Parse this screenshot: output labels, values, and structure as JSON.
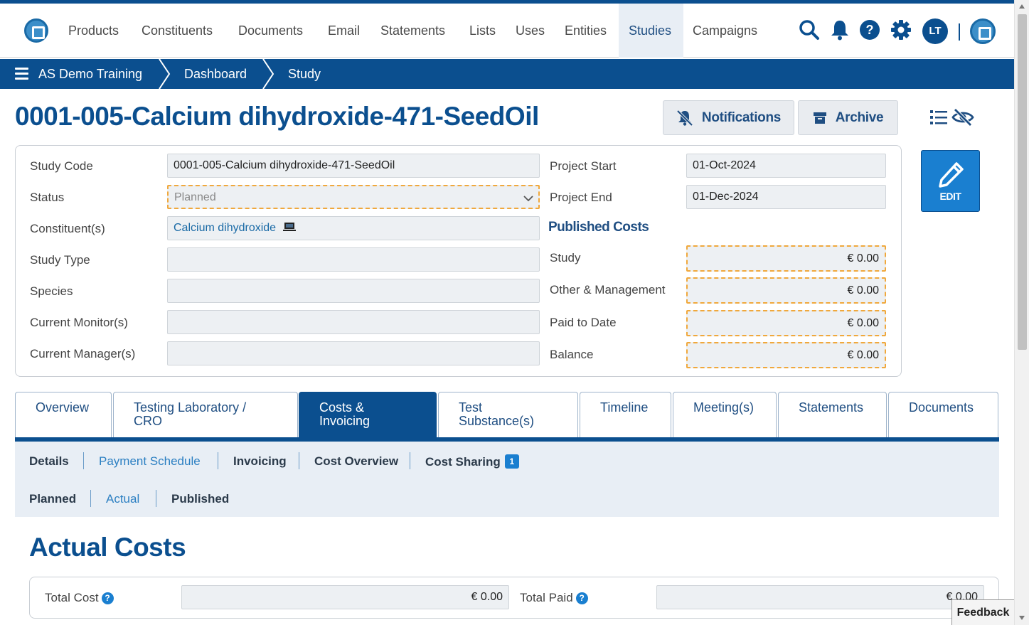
{
  "nav": {
    "items": [
      "Products",
      "Constituents",
      "Documents",
      "Email",
      "Statements",
      "Lists",
      "Uses",
      "Entities",
      "Studies",
      "Campaigns"
    ],
    "active": "Studies",
    "avatar": "LT"
  },
  "breadcrumb": {
    "items": [
      "AS Demo Training",
      "Dashboard",
      "Study"
    ]
  },
  "header": {
    "title": "0001-005-Calcium dihydroxide-471-SeedOil",
    "notifications_label": "Notifications",
    "archive_label": "Archive",
    "edit_label": "EDIT"
  },
  "form": {
    "left": [
      {
        "label": "Study Code",
        "value": "0001-005-Calcium dihydroxide-471-SeedOil"
      },
      {
        "label": "Status",
        "value": "Planned"
      },
      {
        "label": "Constituent(s)",
        "value": "Calcium dihydroxide"
      },
      {
        "label": "Study Type",
        "value": ""
      },
      {
        "label": "Species",
        "value": ""
      },
      {
        "label": "Current Monitor(s)",
        "value": ""
      },
      {
        "label": "Current Manager(s)",
        "value": ""
      }
    ],
    "right": [
      {
        "label": "Project Start",
        "value": "01-Oct-2024"
      },
      {
        "label": "Project End",
        "value": "01-Dec-2024"
      }
    ],
    "published_costs_heading": "Published Costs",
    "costs": [
      {
        "label": "Study",
        "value": "€ 0.00"
      },
      {
        "label": "Other & Management",
        "value": "€ 0.00"
      },
      {
        "label": "Paid to Date",
        "value": "€ 0.00"
      },
      {
        "label": "Balance",
        "value": "€ 0.00"
      }
    ]
  },
  "tabs": [
    {
      "label": "Overview"
    },
    {
      "label": "Testing Laboratory / CRO"
    },
    {
      "label": "Costs & Invoicing"
    },
    {
      "label": "Test Substance(s)"
    },
    {
      "label": "Timeline"
    },
    {
      "label": "Meeting(s)"
    },
    {
      "label": "Statements"
    },
    {
      "label": "Documents"
    }
  ],
  "active_tab": "Costs & Invoicing",
  "subnav": {
    "row1": [
      "Details",
      "Payment Schedule",
      "Invoicing",
      "Cost Overview",
      "Cost Sharing"
    ],
    "cost_sharing_badge": "1",
    "row2": [
      "Planned",
      "Actual",
      "Published"
    ]
  },
  "actual_costs": {
    "title": "Actual Costs",
    "total_cost_label": "Total Cost",
    "total_cost_value": "€ 0.00",
    "total_paid_label": "Total Paid",
    "total_paid_value": "€ 0.00",
    "help_glyph": "?"
  },
  "feedback_label": "Feedback",
  "colors": {
    "primary": "#0b4f8f",
    "accent": "#1a7fd0",
    "warning_border": "#f0a83c"
  }
}
